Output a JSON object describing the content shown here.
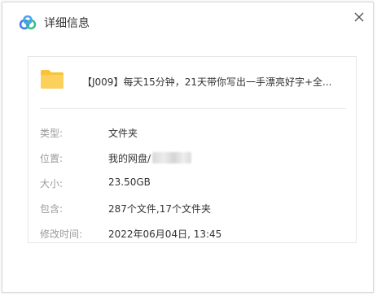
{
  "window": {
    "title": "详细信息",
    "close_label": "close"
  },
  "file": {
    "name": "【J009】每天15分钟，21天带你写出一手漂亮好字+全..."
  },
  "details": [
    {
      "key": "类型:",
      "value": "文件夹"
    },
    {
      "key": "位置:",
      "value": "我的网盘/"
    },
    {
      "key": "大小:",
      "value": "23.50GB"
    },
    {
      "key": "包含:",
      "value": "287个文件,17个文件夹"
    },
    {
      "key": "修改时间:",
      "value": "2022年06月04日, 13:45"
    }
  ],
  "colors": {
    "folder": "#f8c33a",
    "logo_blue": "#3b7bf6",
    "logo_green": "#31c27c"
  },
  "icons": {
    "logo": "baidu-netdisk-logo-icon",
    "folder": "folder-icon",
    "close": "close-icon"
  }
}
